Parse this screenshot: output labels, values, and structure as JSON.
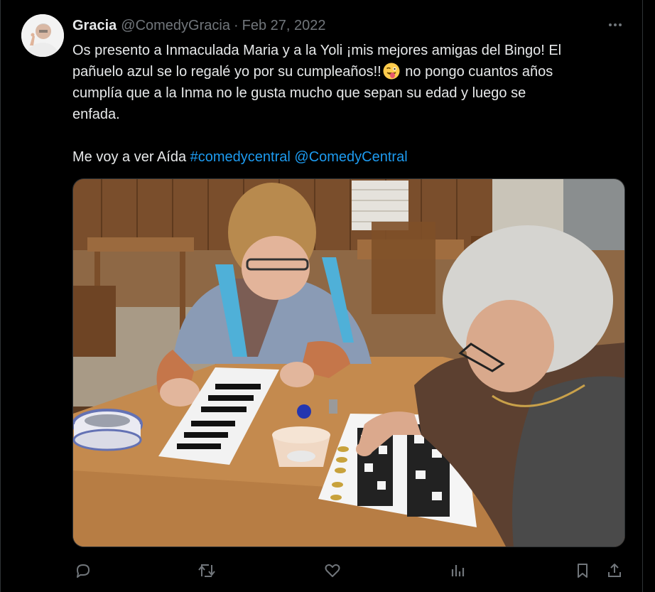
{
  "tweet": {
    "author_name": "Gracia",
    "author_handle": "@ComedyGracia",
    "separator": "·",
    "date": "Feb 27, 2022",
    "text_line1": "Os presento a Inmaculada Maria y a la Yoli ¡mis mejores amigas del Bingo! El",
    "text_line2_a": "pañuelo azul se lo regalé yo por su cumpleaños!!",
    "text_line2_b": "no pongo cuantos años",
    "text_line3": "cumplía que a la Inma no le gusta mucho que sepan su edad y luego se",
    "text_line4": "enfada.",
    "text_line5_a": "Me voy a ver Aída",
    "hashtag": "#comedycentral",
    "mention": "@ComedyCentral"
  },
  "icons": {
    "more": "more-dots-icon",
    "emoji": "winking-face-with-tongue-emoji",
    "reply": "reply-icon",
    "retweet": "retweet-icon",
    "like": "heart-icon",
    "views": "views-icon",
    "bookmark": "bookmark-icon",
    "share": "share-icon"
  },
  "colors": {
    "background": "#000000",
    "text": "#e7e9ea",
    "muted": "#71767b",
    "link": "#1d9bf0",
    "border": "#2f3336"
  }
}
